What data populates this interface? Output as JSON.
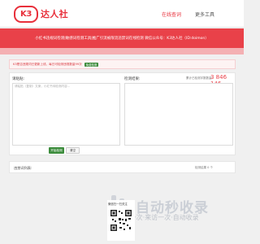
{
  "header": {
    "logo_mark": "K3",
    "logo_text": "达人社",
    "nav": [
      {
        "label": "在线查词"
      },
      {
        "label": "更多工具"
      }
    ]
  },
  "banner": {
    "text": "小红书违规词检测|敏感词检测工具|推广引流被限流违禁词在线检测  微信公众号：K3达人社（ID:doimon）"
  },
  "notice": {
    "text": "K3是否违规词已更新上线，每日可检测违规数量99次",
    "tag": "免费检测"
  },
  "editor": {
    "input_label": "请粘贴:",
    "output_label": "检测结果:",
    "quota_label": "累计已检测字数数量:",
    "quota_value": "3 846 146",
    "input_placeholder": "请粘贴（复制）文案，小红书待检测内容...",
    "generate_label": "开始检测",
    "clear_label": "清空"
  },
  "summary": {
    "label": "违禁词列表:",
    "right_text": "检测结果 0 个"
  },
  "watermark": {
    "main": "自动秒收录",
    "sub": "·来访一次·来访一次·自动收录"
  },
  "qr": {
    "label": "微信扫一扫关注"
  },
  "colors": {
    "brand_red": "#e94149",
    "accent_green": "#3c8c3c"
  }
}
